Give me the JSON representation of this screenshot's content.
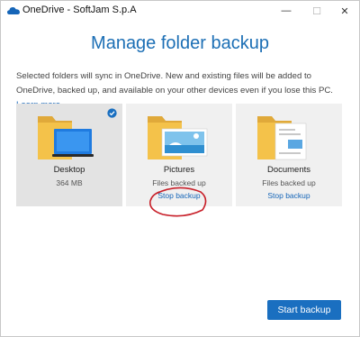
{
  "window": {
    "title": "OneDrive - SoftJam S.p.A",
    "min_glyph": "—",
    "max_glyph": "☐",
    "close_glyph": "✕"
  },
  "heading": "Manage folder backup",
  "description": {
    "text": "Selected folders will sync in OneDrive. New and existing files will be added to OneDrive, backed up, and available on your other devices even if you lose this PC.",
    "link": "Learn more."
  },
  "cards": [
    {
      "label": "Desktop",
      "sub": "364 MB",
      "link": "",
      "selected": true
    },
    {
      "label": "Pictures",
      "sub": "Files backed up",
      "link": "Stop backup",
      "selected": false
    },
    {
      "label": "Documents",
      "sub": "Files backed up",
      "link": "Stop backup",
      "selected": false
    }
  ],
  "primary_button": "Start backup",
  "colors": {
    "accent": "#1a6fc0",
    "heading": "#1c6fb5",
    "annotation": "#c8202a",
    "folder": "#f4c24a"
  }
}
